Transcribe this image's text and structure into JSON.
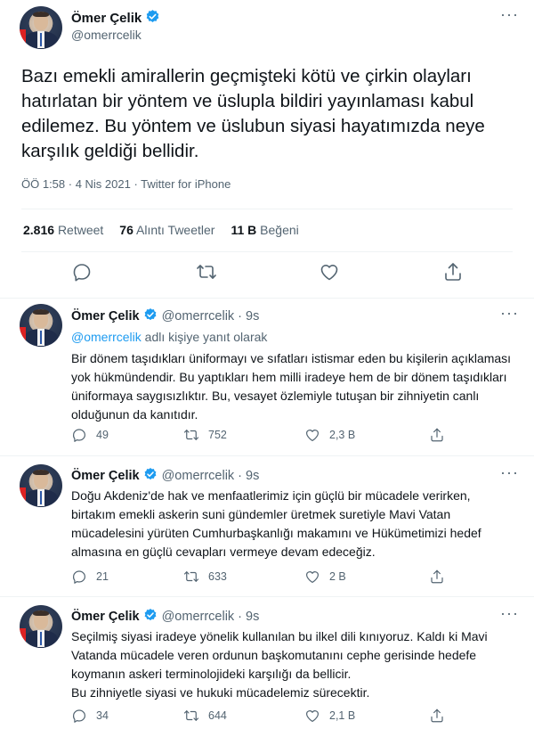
{
  "main": {
    "display_name": "Ömer Çelik",
    "handle": "@omerrcelik",
    "text": "Bazı emekli amirallerin geçmişteki kötü ve çirkin olayları hatırlatan bir yöntem ve üslupla bildiri yayınlaması kabul edilemez. Bu yöntem ve üslubun siyasi hayatımızda neye karşılık geldiği bellidir.",
    "meta": "ÖÖ 1:58 · 4 Nis 2021 · Twitter for iPhone",
    "retweets_count": "2.816",
    "retweets_label": "Retweet",
    "quotes_count": "76",
    "quotes_label": "Alıntı Tweetler",
    "likes_count": "11 B",
    "likes_label": "Beğeni"
  },
  "replies": [
    {
      "display_name": "Ömer Çelik",
      "handle": "@omerrcelik",
      "time": "· 9s",
      "reply_to_mention": "@omerrcelik",
      "reply_to_suffix": "adlı kişiye yanıt olarak",
      "text": "Bir dönem taşıdıkları üniformayı ve sıfatları istismar eden bu kişilerin açıklaması yok hükmündendir. Bu yaptıkları hem milli iradeye hem de bir dönem taşıdıkları üniformaya saygısızlıktır. Bu, vesayet özlemiyle tutuşan bir zihniyetin canlı olduğunun da kanıtıdır.",
      "replies": "49",
      "retweets": "752",
      "likes": "2,3 B"
    },
    {
      "display_name": "Ömer Çelik",
      "handle": "@omerrcelik",
      "time": "· 9s",
      "text": "Doğu Akdeniz'de hak ve menfaatlerimiz için güçlü bir mücadele verirken, birtakım emekli askerin suni gündemler üretmek suretiyle Mavi Vatan mücadelesini yürüten Cumhurbaşkanlığı makamını ve Hükümetimizi hedef almasına en güçlü cevapları vermeye devam edeceğiz.",
      "replies": "21",
      "retweets": "633",
      "likes": "2 B"
    },
    {
      "display_name": "Ömer Çelik",
      "handle": "@omerrcelik",
      "time": "· 9s",
      "text": "Seçilmiş siyasi iradeye yönelik kullanılan bu ilkel dili kınıyoruz. Kaldı ki Mavi Vatanda mücadele veren ordunun başkomutanını cephe gerisinde hedefe koymanın askeri terminolojideki karşılığı da bellicir.\nBu zihniyetle siyasi ve hukuki mücadelemiz sürecektir.",
      "replies": "34",
      "retweets": "644",
      "likes": "2,1 B"
    }
  ],
  "icons": {
    "more": "more-icon",
    "verified": "verified-badge-icon",
    "reply": "reply-icon",
    "retweet": "retweet-icon",
    "like": "heart-icon",
    "share": "share-icon"
  },
  "colors": {
    "accent": "#1d9bf0",
    "muted": "#536471",
    "text": "#0f1419"
  }
}
